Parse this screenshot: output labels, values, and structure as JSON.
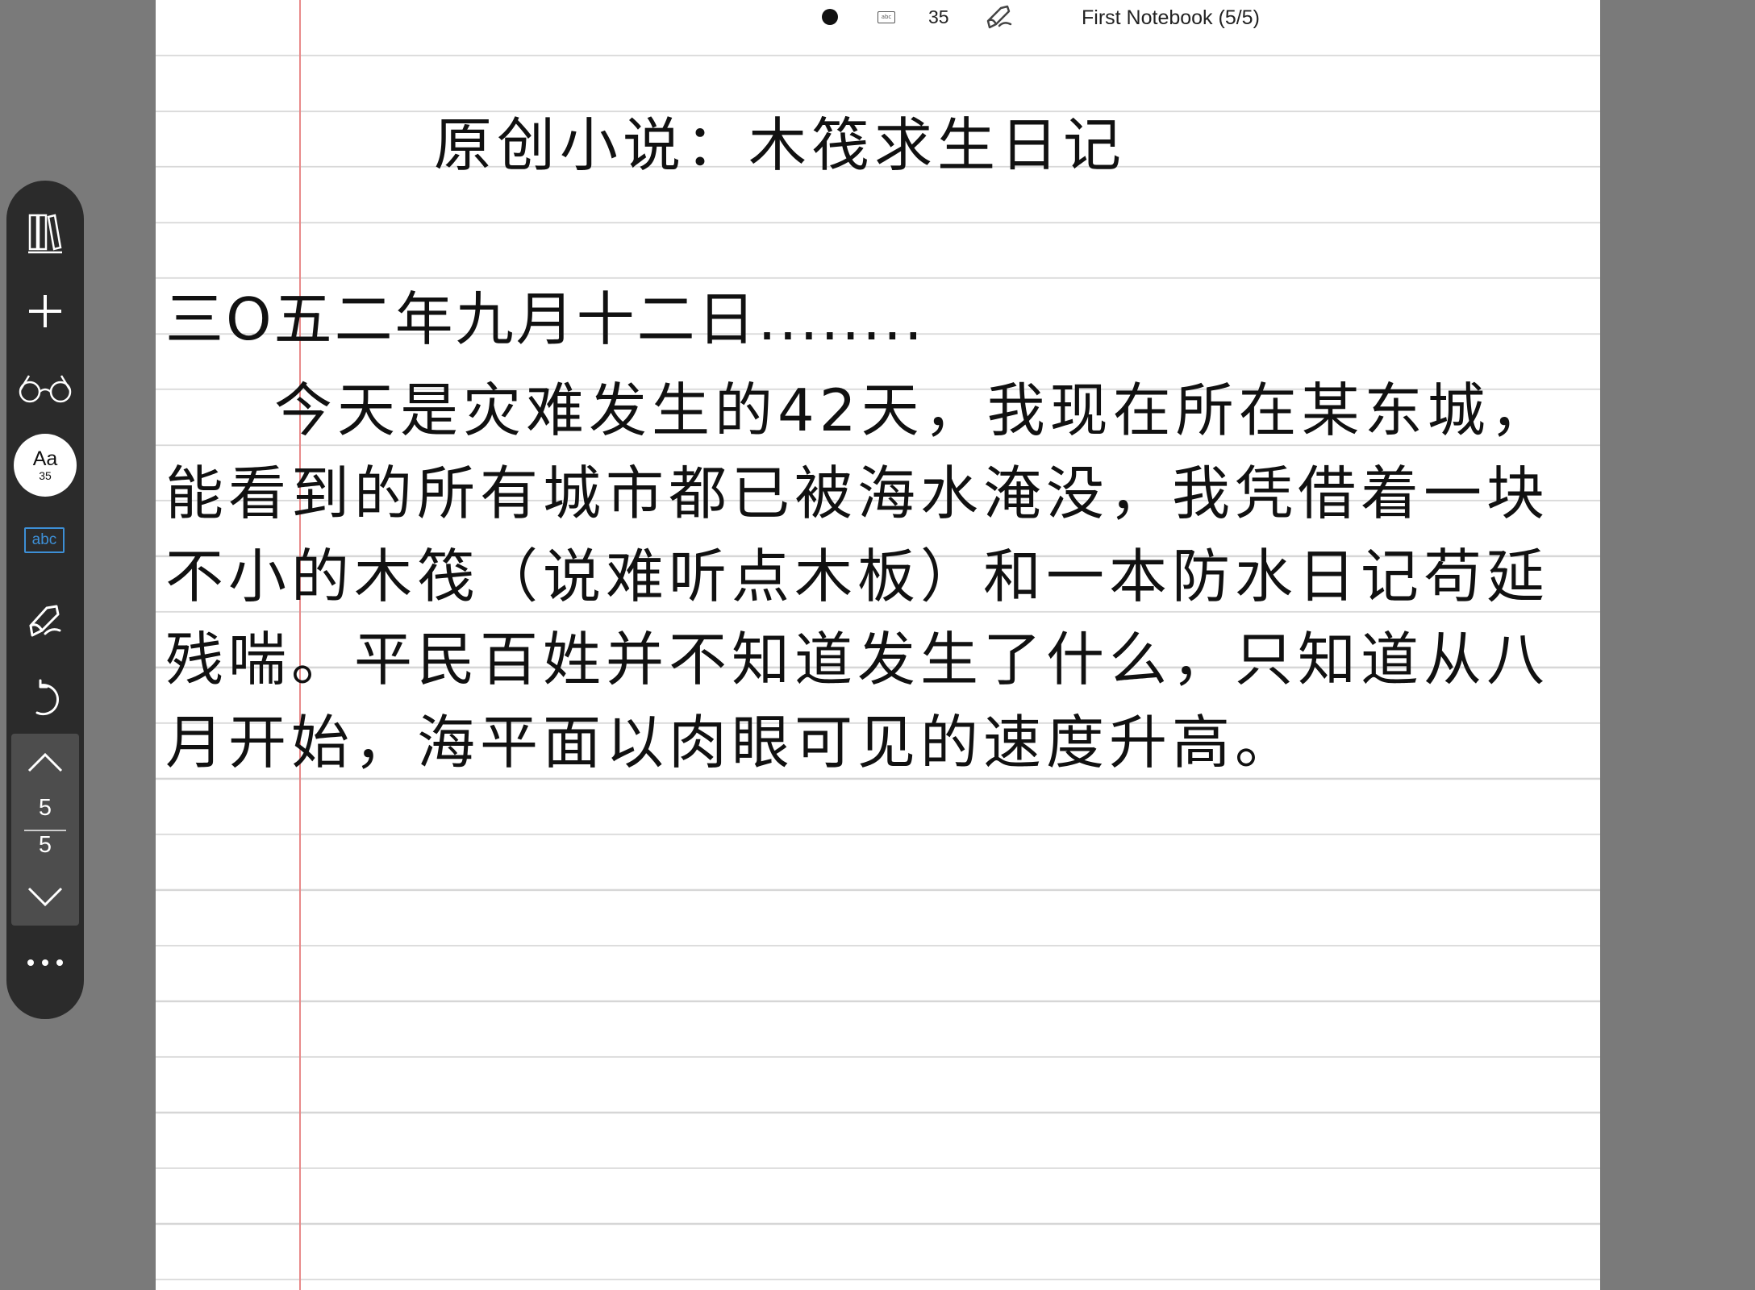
{
  "status_bar": {
    "keyboard_label": "abc",
    "font_size": "35",
    "notebook_title": "First Notebook (5/5)"
  },
  "document": {
    "title": "原创小说：木筏求生日记",
    "date_line": "三O五二年九月十二日........",
    "body": "今天是灾难发生的42天，我现在所在某东城，能看到的所有城市都已被海水淹没，我凭借着一块不小的木筏（说难听点木板）和一本防水日记苟延残喘。平民百姓并不知道发生了什么，只知道从八月开始，海平面以肉眼可见的速度升高。"
  },
  "toolbar": {
    "font_button": {
      "label": "Aa",
      "size": "35"
    },
    "text_mode_label": "abc",
    "pager": {
      "current": "5",
      "total": "5"
    }
  },
  "icons": [
    "library-icon",
    "add-icon",
    "glasses-icon",
    "pen-icon",
    "undo-icon",
    "chevron-up-icon",
    "chevron-down-icon",
    "more-icon"
  ],
  "colors": {
    "accent": "#3d8fd6",
    "margin_line": "#e88a8a",
    "toolbar_bg": "#2b2b2b"
  }
}
